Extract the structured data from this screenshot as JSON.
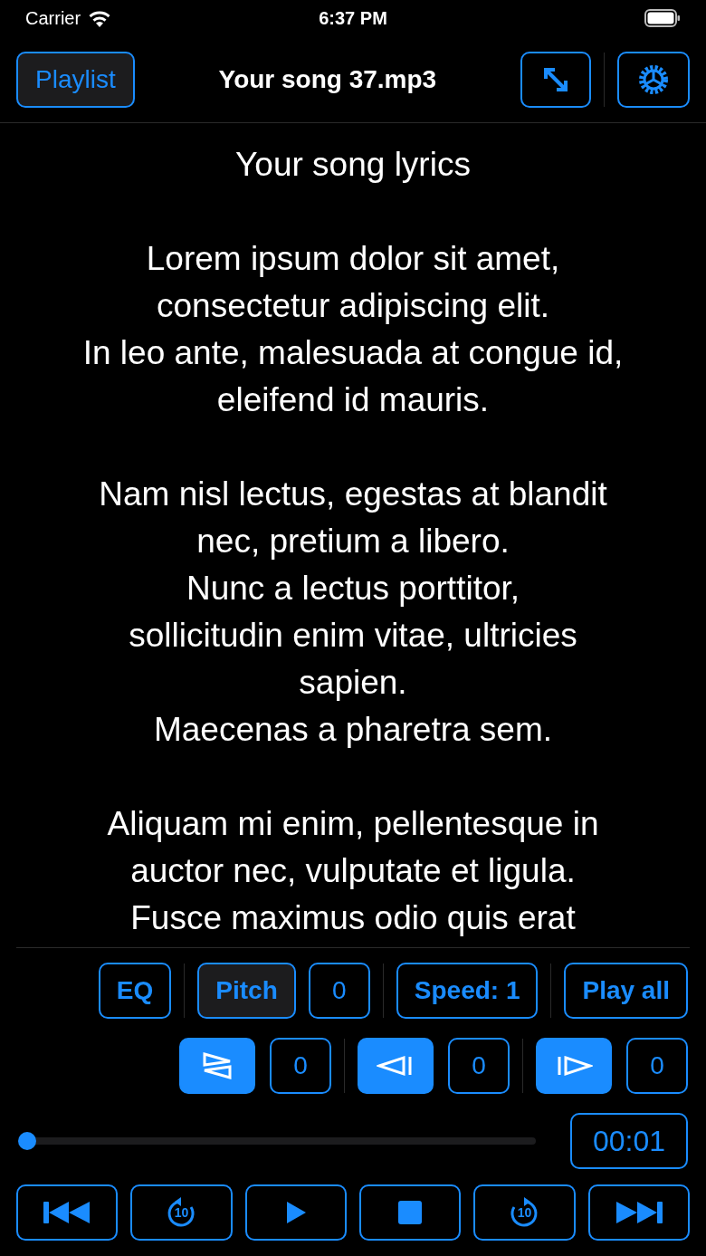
{
  "status_bar": {
    "carrier": "Carrier",
    "time": "6:37 PM"
  },
  "header": {
    "playlist_button": {
      "label": "Playlist",
      "selected": true
    },
    "title": "Your song 37.mp3"
  },
  "lyrics": {
    "title": "Your song lyrics",
    "stanzas": [
      [
        "Lorem ipsum dolor sit amet,",
        "consectetur adipiscing elit.",
        "In leo ante, malesuada at congue id,",
        "eleifend id mauris."
      ],
      [
        "Nam nisl lectus, egestas at blandit",
        "nec, pretium a libero.",
        "Nunc a lectus porttitor,",
        "sollicitudin enim vitae, ultricies",
        "sapien.",
        "Maecenas a pharetra sem."
      ],
      [
        "Aliquam mi enim, pellentesque in",
        "auctor nec, vulputate et ligula.",
        "Fusce maximus odio quis erat"
      ]
    ]
  },
  "controls": [
    {
      "kind": "button",
      "label": "EQ",
      "selected": false
    },
    {
      "kind": "divider"
    },
    {
      "kind": "button",
      "label": "Pitch",
      "selected": true
    },
    {
      "kind": "value",
      "label": "0"
    },
    {
      "kind": "divider"
    },
    {
      "kind": "button",
      "label": "Speed: 1",
      "selected": false
    },
    {
      "kind": "divider"
    },
    {
      "kind": "button",
      "label": "Play all",
      "selected": false
    }
  ],
  "toggles": [
    {
      "kind": "flip",
      "on": true,
      "value": "0"
    },
    {
      "kind": "start",
      "on": true,
      "value": "0"
    },
    {
      "kind": "end",
      "on": true,
      "value": "0"
    }
  ],
  "progress": {
    "level": 0.0,
    "time": "00:01"
  },
  "transport": [
    {
      "kind": "previous"
    },
    {
      "kind": "back",
      "label": "10"
    },
    {
      "kind": "play"
    },
    {
      "kind": "stop"
    },
    {
      "kind": "forward",
      "label": "10"
    },
    {
      "kind": "next"
    }
  ]
}
